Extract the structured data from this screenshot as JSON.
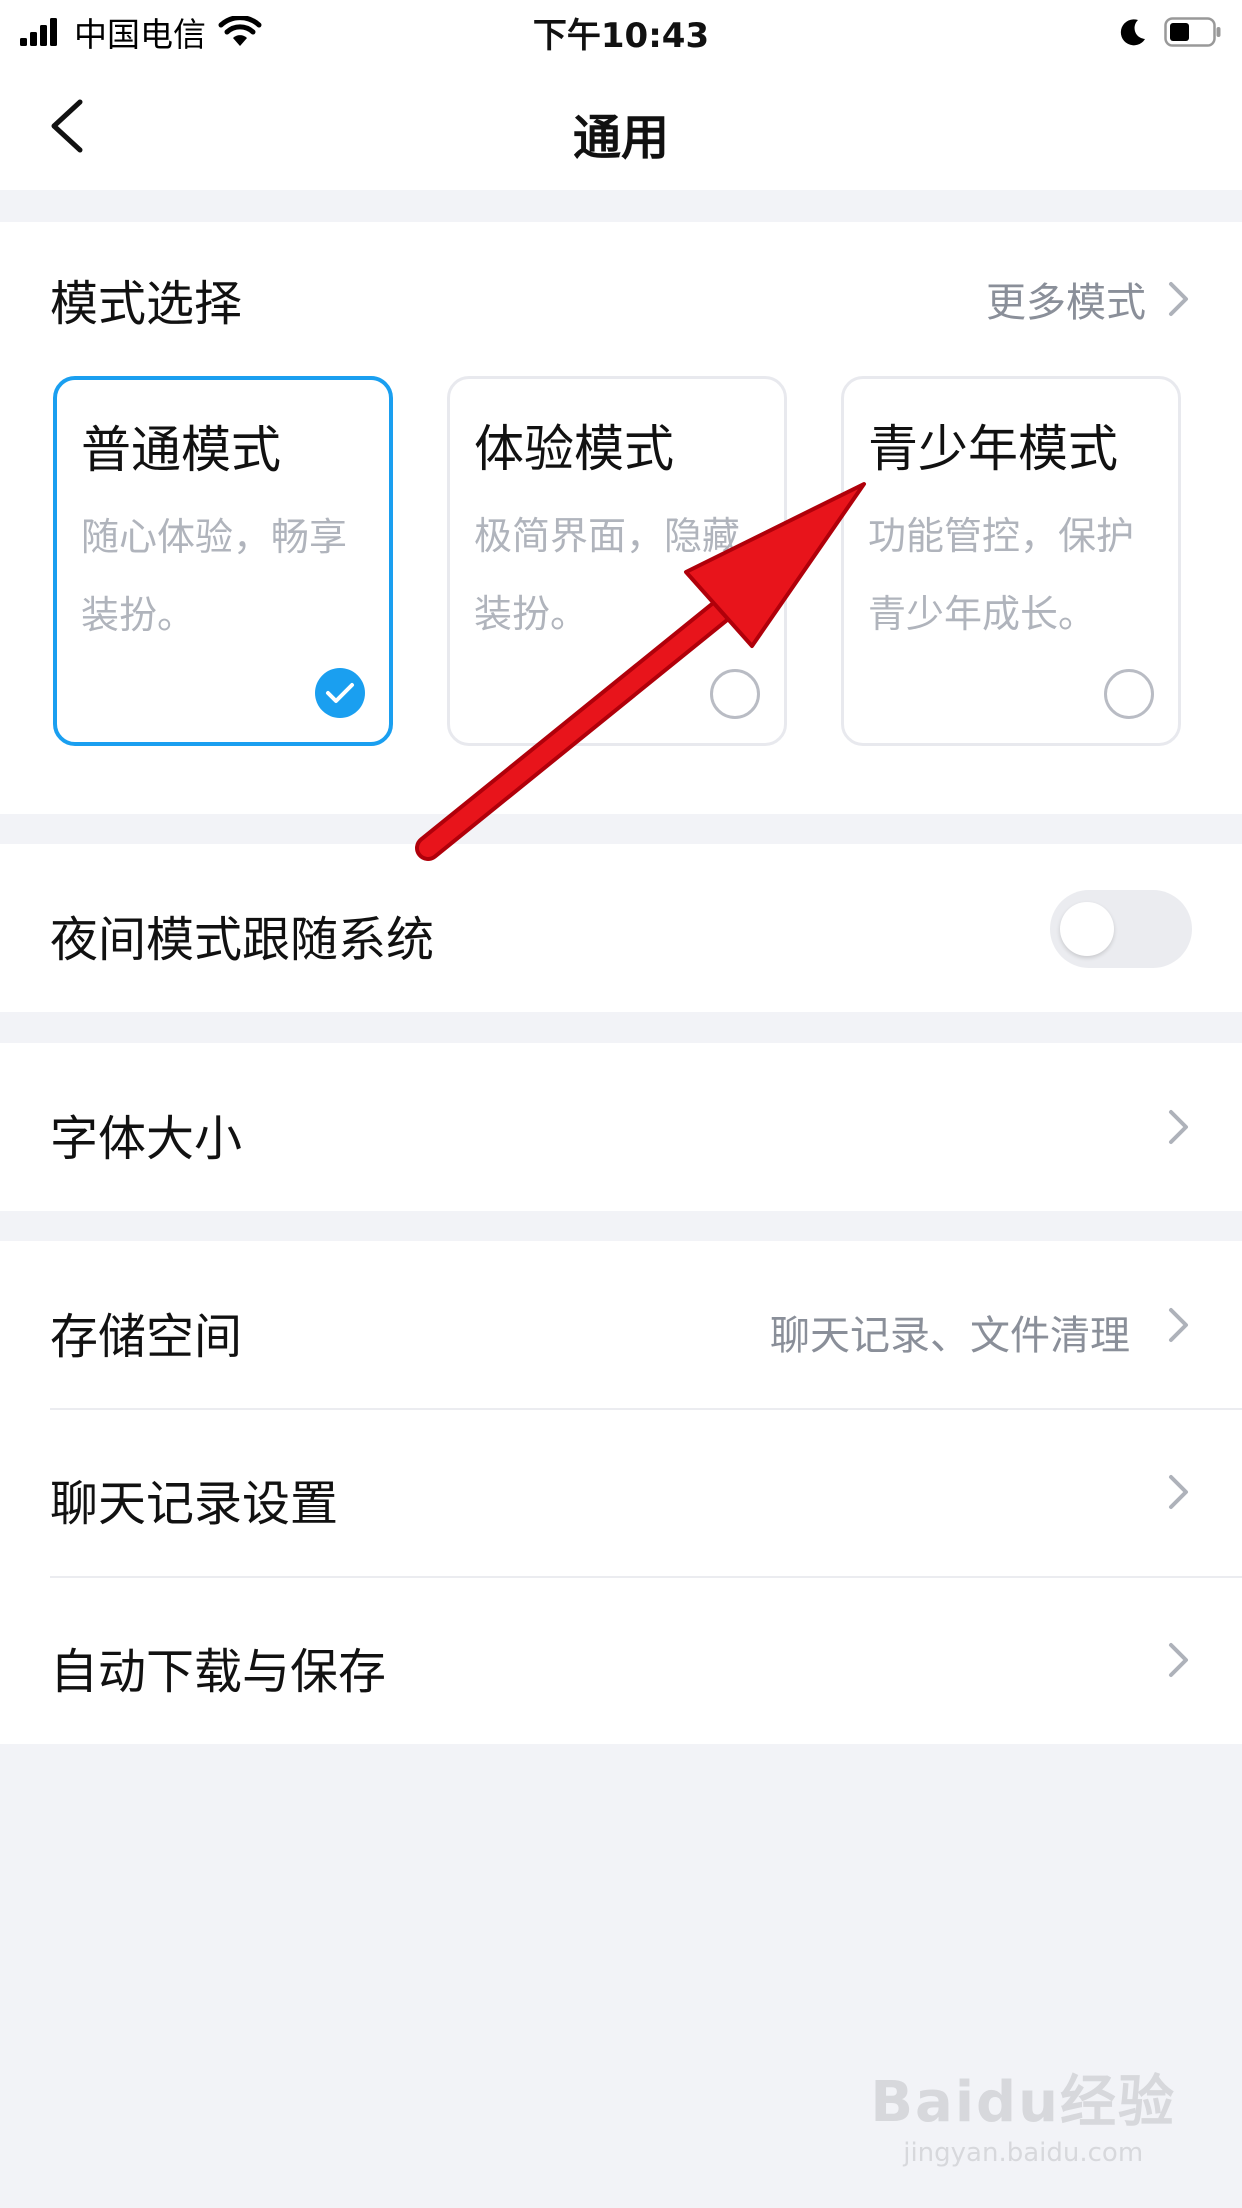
{
  "status_bar": {
    "carrier": "中国电信",
    "time": "下午10:43"
  },
  "nav": {
    "title": "通用"
  },
  "mode_select": {
    "heading": "模式选择",
    "more_label": "更多模式",
    "modes": [
      {
        "title": "普通模式",
        "desc": "随心体验，畅享\n装扮。",
        "selected": true
      },
      {
        "title": "体验模式",
        "desc": "极简界面，隐藏\n装扮。",
        "selected": false
      },
      {
        "title": "青少年模式",
        "desc": "功能管控，保护\n青少年成长。",
        "selected": false
      }
    ]
  },
  "night_mode": {
    "label": "夜间模式跟随系统",
    "enabled": false
  },
  "font_size": {
    "label": "字体大小"
  },
  "storage": {
    "label": "存储空间",
    "detail": "聊天记录、文件清理"
  },
  "chat_history": {
    "label": "聊天记录设置"
  },
  "auto_download": {
    "label": "自动下载与保存"
  },
  "watermark": {
    "brand": "Baidu经验",
    "url": "jingyan.baidu.com"
  },
  "colors": {
    "accent": "#1a9ff0",
    "annotation_arrow": "#e8141b"
  }
}
